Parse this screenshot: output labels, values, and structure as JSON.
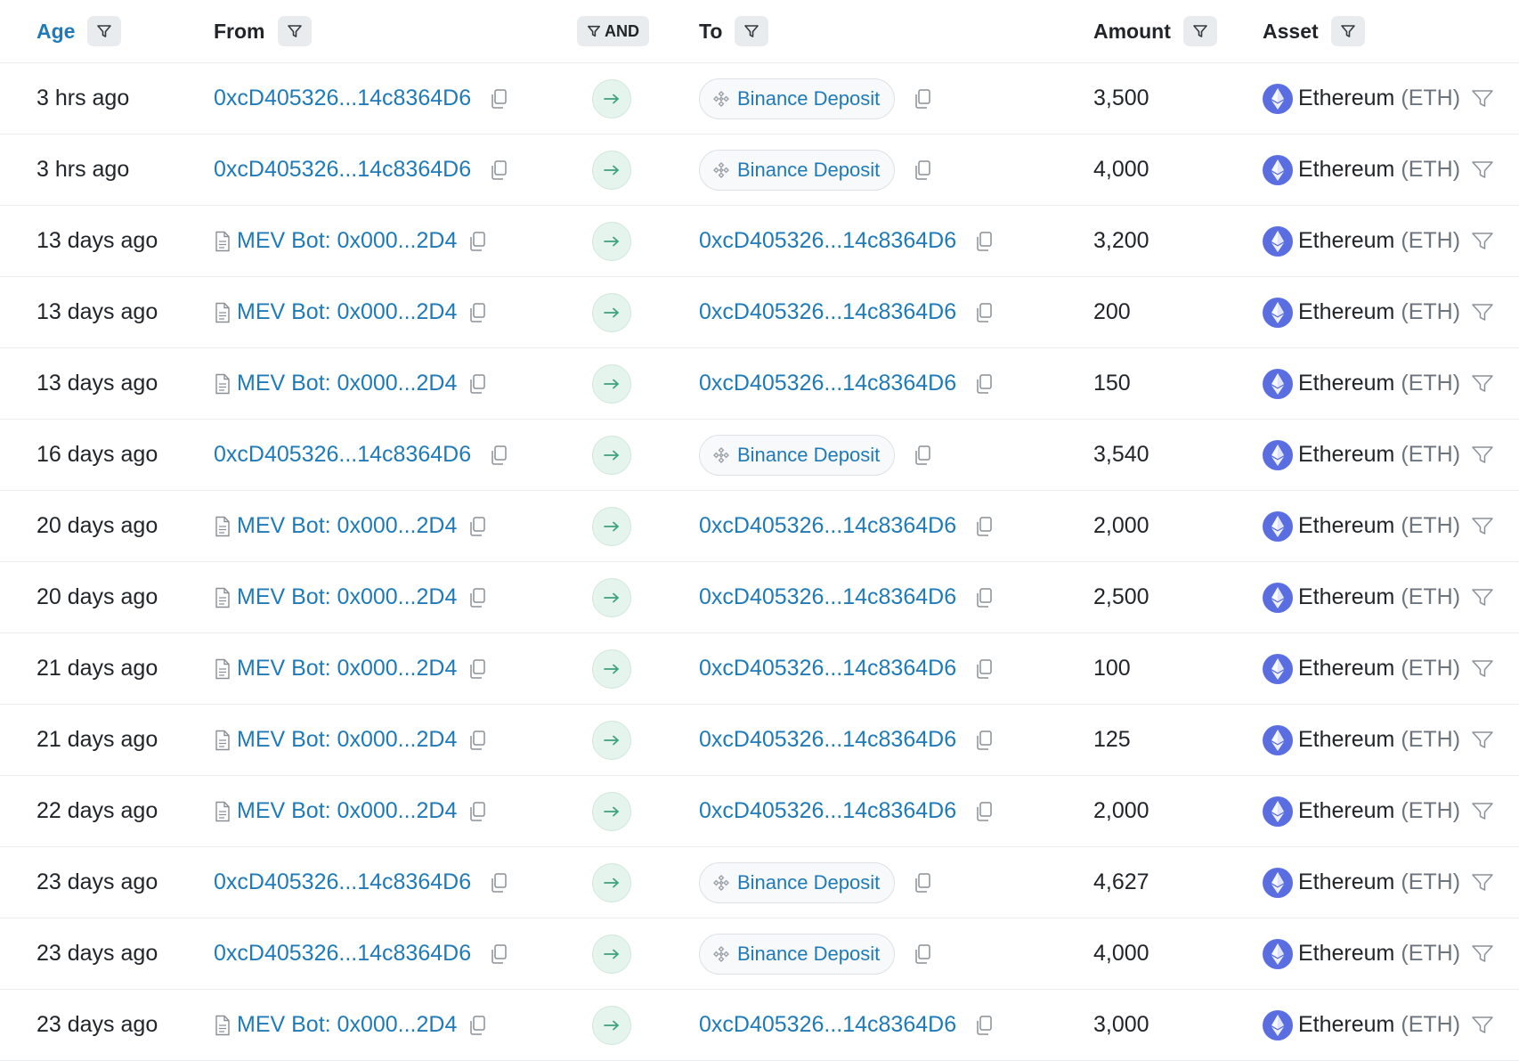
{
  "header": {
    "age": "Age",
    "from": "From",
    "and": "AND",
    "to": "To",
    "amount": "Amount",
    "asset": "Asset"
  },
  "rows": [
    {
      "age": "3 hrs ago",
      "from": "0xcD405326...14c8364D6",
      "from_type": "address",
      "to": "Binance Deposit",
      "to_type": "label",
      "amount": "3,500",
      "asset": "Ethereum",
      "symbol": "(ETH)"
    },
    {
      "age": "3 hrs ago",
      "from": "0xcD405326...14c8364D6",
      "from_type": "address",
      "to": "Binance Deposit",
      "to_type": "label",
      "amount": "4,000",
      "asset": "Ethereum",
      "symbol": "(ETH)"
    },
    {
      "age": "13 days ago",
      "from": "MEV Bot: 0x000...2D4",
      "from_type": "contract",
      "to": "0xcD405326...14c8364D6",
      "to_type": "address",
      "amount": "3,200",
      "asset": "Ethereum",
      "symbol": "(ETH)"
    },
    {
      "age": "13 days ago",
      "from": "MEV Bot: 0x000...2D4",
      "from_type": "contract",
      "to": "0xcD405326...14c8364D6",
      "to_type": "address",
      "amount": "200",
      "asset": "Ethereum",
      "symbol": "(ETH)"
    },
    {
      "age": "13 days ago",
      "from": "MEV Bot: 0x000...2D4",
      "from_type": "contract",
      "to": "0xcD405326...14c8364D6",
      "to_type": "address",
      "amount": "150",
      "asset": "Ethereum",
      "symbol": "(ETH)"
    },
    {
      "age": "16 days ago",
      "from": "0xcD405326...14c8364D6",
      "from_type": "address",
      "to": "Binance Deposit",
      "to_type": "label",
      "amount": "3,540",
      "asset": "Ethereum",
      "symbol": "(ETH)"
    },
    {
      "age": "20 days ago",
      "from": "MEV Bot: 0x000...2D4",
      "from_type": "contract",
      "to": "0xcD405326...14c8364D6",
      "to_type": "address",
      "amount": "2,000",
      "asset": "Ethereum",
      "symbol": "(ETH)"
    },
    {
      "age": "20 days ago",
      "from": "MEV Bot: 0x000...2D4",
      "from_type": "contract",
      "to": "0xcD405326...14c8364D6",
      "to_type": "address",
      "amount": "2,500",
      "asset": "Ethereum",
      "symbol": "(ETH)"
    },
    {
      "age": "21 days ago",
      "from": "MEV Bot: 0x000...2D4",
      "from_type": "contract",
      "to": "0xcD405326...14c8364D6",
      "to_type": "address",
      "amount": "100",
      "asset": "Ethereum",
      "symbol": "(ETH)"
    },
    {
      "age": "21 days ago",
      "from": "MEV Bot: 0x000...2D4",
      "from_type": "contract",
      "to": "0xcD405326...14c8364D6",
      "to_type": "address",
      "amount": "125",
      "asset": "Ethereum",
      "symbol": "(ETH)"
    },
    {
      "age": "22 days ago",
      "from": "MEV Bot: 0x000...2D4",
      "from_type": "contract",
      "to": "0xcD405326...14c8364D6",
      "to_type": "address",
      "amount": "2,000",
      "asset": "Ethereum",
      "symbol": "(ETH)"
    },
    {
      "age": "23 days ago",
      "from": "0xcD405326...14c8364D6",
      "from_type": "address",
      "to": "Binance Deposit",
      "to_type": "label",
      "amount": "4,627",
      "asset": "Ethereum",
      "symbol": "(ETH)"
    },
    {
      "age": "23 days ago",
      "from": "0xcD405326...14c8364D6",
      "from_type": "address",
      "to": "Binance Deposit",
      "to_type": "label",
      "amount": "4,000",
      "asset": "Ethereum",
      "symbol": "(ETH)"
    },
    {
      "age": "23 days ago",
      "from": "MEV Bot: 0x000...2D4",
      "from_type": "contract",
      "to": "0xcD405326...14c8364D6",
      "to_type": "address",
      "amount": "3,000",
      "asset": "Ethereum",
      "symbol": "(ETH)"
    }
  ],
  "icons": {
    "filter": "funnel-icon",
    "copy": "copy-icon",
    "contract": "document-icon",
    "direction": "arrow-right-icon",
    "exchange": "binance-icon",
    "asset": "ethereum-icon"
  },
  "colors": {
    "link": "#1e7ab8",
    "direction_bg": "#e6f4ee",
    "direction_arrow": "#3aa37a",
    "eth": "#5b6ee1"
  }
}
